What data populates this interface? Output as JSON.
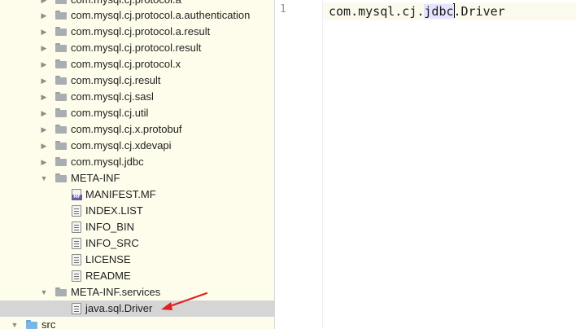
{
  "tree": {
    "items": [
      {
        "label": "com.mysql.cj.protocol.a",
        "kind": "folder",
        "expanded": false
      },
      {
        "label": "com.mysql.cj.protocol.a.authentication",
        "kind": "folder",
        "expanded": false
      },
      {
        "label": "com.mysql.cj.protocol.a.result",
        "kind": "folder",
        "expanded": false
      },
      {
        "label": "com.mysql.cj.protocol.result",
        "kind": "folder",
        "expanded": false
      },
      {
        "label": "com.mysql.cj.protocol.x",
        "kind": "folder",
        "expanded": false
      },
      {
        "label": "com.mysql.cj.result",
        "kind": "folder",
        "expanded": false
      },
      {
        "label": "com.mysql.cj.sasl",
        "kind": "folder",
        "expanded": false
      },
      {
        "label": "com.mysql.cj.util",
        "kind": "folder",
        "expanded": false
      },
      {
        "label": "com.mysql.cj.x.protobuf",
        "kind": "folder",
        "expanded": false
      },
      {
        "label": "com.mysql.cj.xdevapi",
        "kind": "folder",
        "expanded": false
      },
      {
        "label": "com.mysql.jdbc",
        "kind": "folder",
        "expanded": false
      },
      {
        "label": "META-INF",
        "kind": "folder",
        "expanded": true
      },
      {
        "label": "MANIFEST.MF",
        "kind": "manifest"
      },
      {
        "label": "INDEX.LIST",
        "kind": "file"
      },
      {
        "label": "INFO_BIN",
        "kind": "file"
      },
      {
        "label": "INFO_SRC",
        "kind": "file"
      },
      {
        "label": "LICENSE",
        "kind": "file"
      },
      {
        "label": "README",
        "kind": "file"
      },
      {
        "label": "META-INF.services",
        "kind": "folder",
        "expanded": true
      },
      {
        "label": "java.sql.Driver",
        "kind": "file",
        "selected": true
      },
      {
        "label": "src",
        "kind": "src-folder",
        "expanded": true
      }
    ],
    "manifest_badge": "MF"
  },
  "editor": {
    "line_number": "1",
    "code_before": "com.mysql.cj.",
    "code_highlight": "jdbc",
    "code_after": ".Driver"
  },
  "colors": {
    "tree_background": "#fefdeb",
    "selection": "#d5d5d5",
    "annotation_arrow": "#e02020"
  }
}
